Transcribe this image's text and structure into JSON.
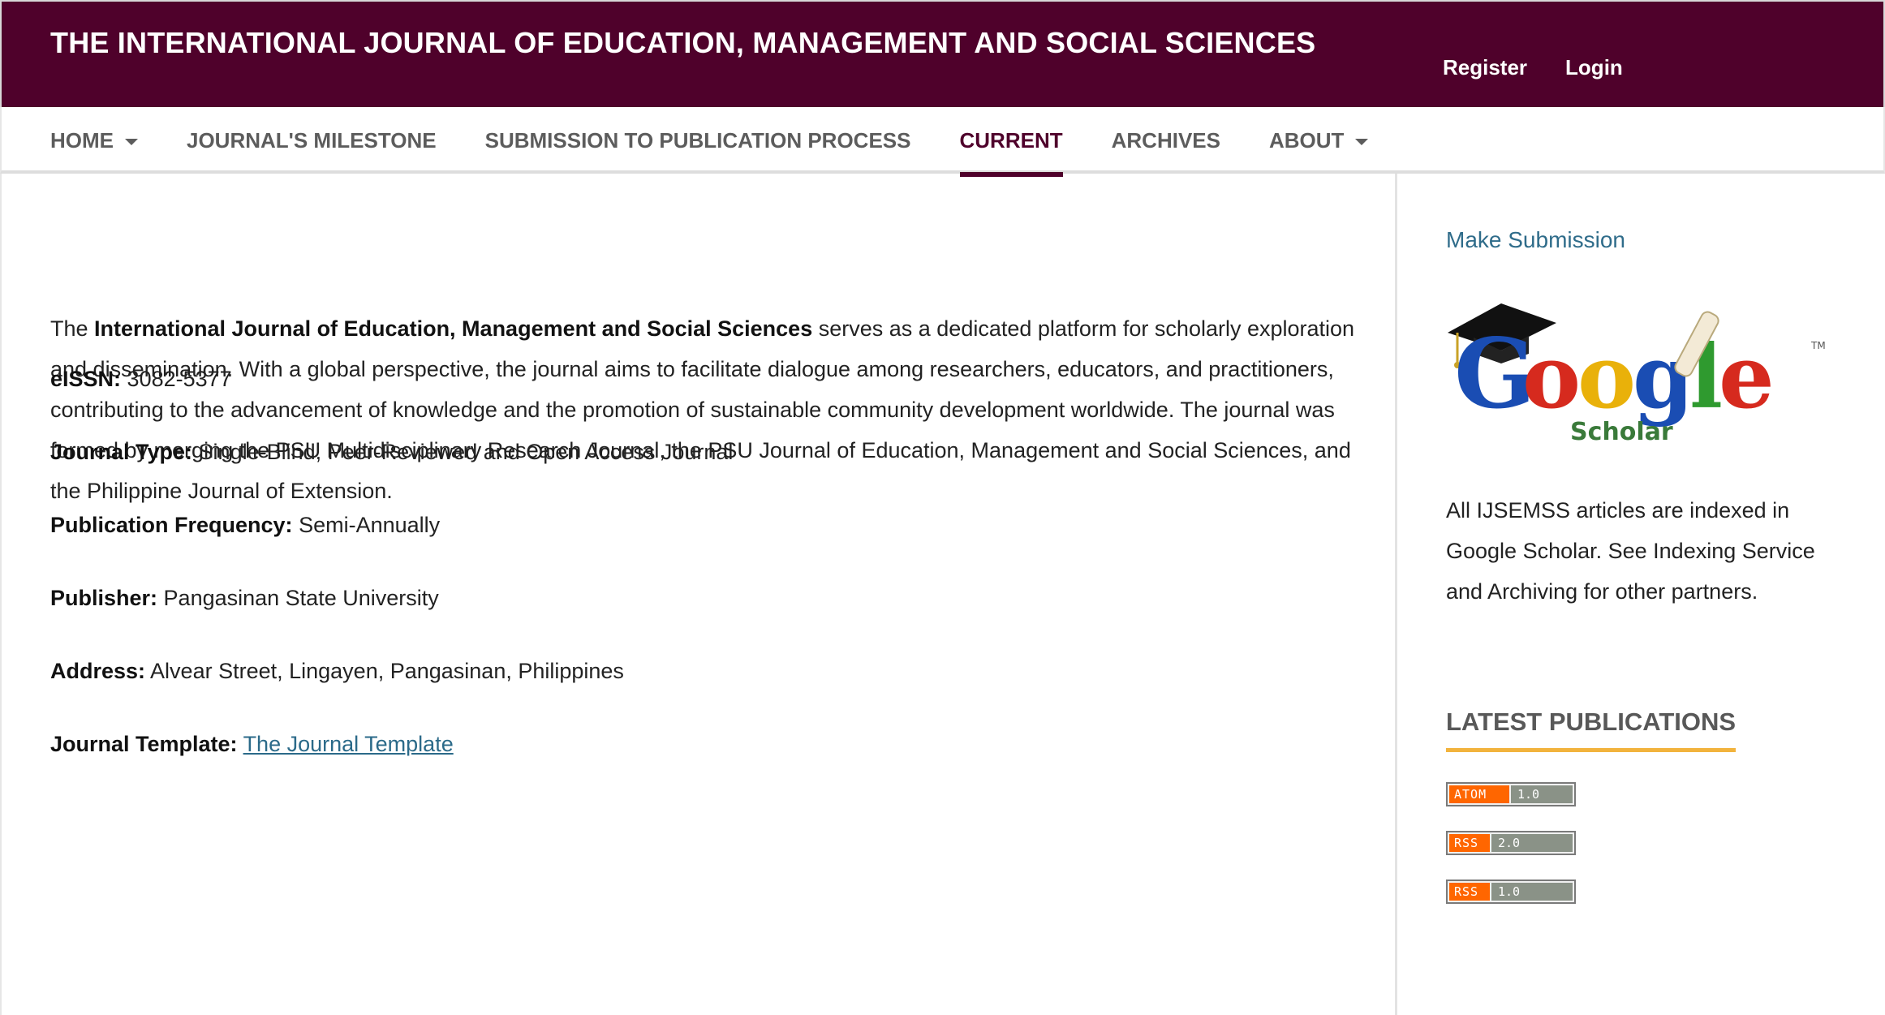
{
  "header": {
    "site_title": "THE INTERNATIONAL JOURNAL OF EDUCATION, MANAGEMENT AND SOCIAL SCIENCES",
    "register_label": "Register",
    "login_label": "Login",
    "brand_color": "#4f012b"
  },
  "nav": {
    "items": [
      {
        "label": "HOME",
        "has_dropdown": true
      },
      {
        "label": "JOURNAL'S MILESTONE",
        "has_dropdown": false
      },
      {
        "label": "SUBMISSION TO PUBLICATION PROCESS",
        "has_dropdown": false
      },
      {
        "label": "CURRENT",
        "has_dropdown": false,
        "active": true
      },
      {
        "label": "ARCHIVES",
        "has_dropdown": false
      },
      {
        "label": "ABOUT",
        "has_dropdown": true
      }
    ]
  },
  "main": {
    "intro_prefix": "The ",
    "intro_bold": "International Journal of Education, Management and Social Sciences",
    "intro_rest": " serves as a dedicated platform for scholarly exploration and dissemination. With a global perspective, the journal aims to facilitate dialogue among researchers, educators, and practitioners, contributing to the advancement of knowledge and the promotion of sustainable community development worldwide. The journal was formed by merging the PSU Multidisciplinary Research Journal, the PSU Journal of Education, Management and Social Sciences, and the Philippine Journal of Extension.",
    "fields": {
      "eissn_label": "eISSN:",
      "eissn_value": "3082-5377",
      "type_label": "Journal Type:",
      "type_value": "Single-Blind, Peer-Reviewed and Open Access Journal",
      "freq_label": "Publication Frequency:",
      "freq_value": "Semi-Annually",
      "publisher_label": "Publisher:",
      "publisher_value": "Pangasinan State University",
      "address_label": "Address:",
      "address_value": "Alvear Street, Lingayen, Pangasinan, Philippines",
      "template_label": "Journal Template:",
      "template_link": "The Journal Template"
    }
  },
  "sidebar": {
    "make_submission": "Make Submission",
    "logo": {
      "word": "Google",
      "sub": "Scholar",
      "tm": "TM"
    },
    "index_text": "All IJSEMSS articles are indexed in Google Scholar. See Indexing Service and Archiving for other partners.",
    "latest_title": "LATEST PUBLICATIONS",
    "feeds": [
      {
        "key": "ATOM",
        "ver": "1.0"
      },
      {
        "key": "RSS",
        "ver": "2.0"
      },
      {
        "key": "RSS",
        "ver": "1.0"
      }
    ],
    "accent_color": "#f2b33d"
  }
}
